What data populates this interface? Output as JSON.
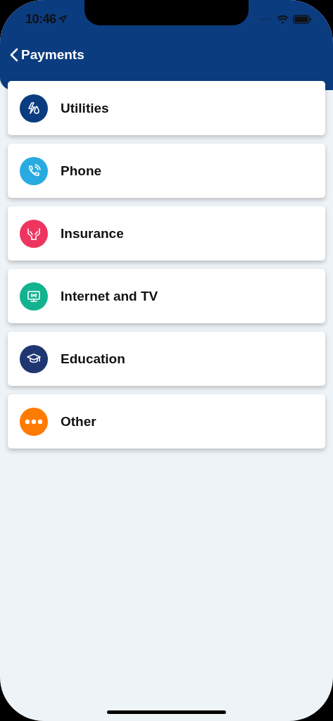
{
  "status_bar": {
    "time": "10:46"
  },
  "nav": {
    "back_label": "Payments"
  },
  "categories": [
    {
      "label": "Utilities",
      "kind": "utilities",
      "color": "#0b3c80"
    },
    {
      "label": "Phone",
      "kind": "phone",
      "color": "#29abe2"
    },
    {
      "label": "Insurance",
      "kind": "insurance",
      "color": "#ee3560"
    },
    {
      "label": "Internet and TV",
      "kind": "internet",
      "color": "#13b38f"
    },
    {
      "label": "Education",
      "kind": "education",
      "color": "#1f3670"
    },
    {
      "label": "Other",
      "kind": "other",
      "color": "#ff7a00"
    }
  ]
}
